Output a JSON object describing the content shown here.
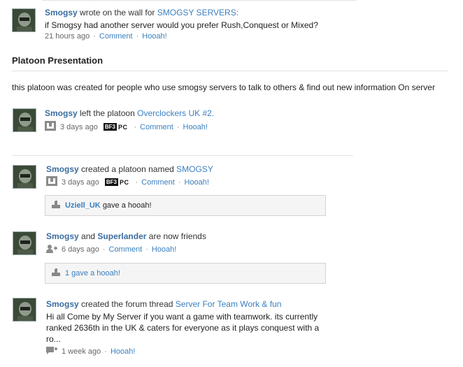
{
  "feed": [
    {
      "user": "Smogsy",
      "action": "wrote on the wall for",
      "target": "SMOGSY SERVERS:",
      "body": "if Smogsy had another server would you prefer Rush,Conquest or Mixed?",
      "time": "21 hours ago",
      "comment": "Comment",
      "hooah": "Hooah!"
    }
  ],
  "platoon": {
    "heading": "Platoon Presentation",
    "description": "this platoon was created for people who use smogsy servers to talk to others & find out new information On server"
  },
  "events": [
    {
      "user": "Smogsy",
      "action": "left the platoon",
      "target": "Overclockers UK #2.",
      "time": "3 days ago",
      "platform_b": "BF3",
      "platform_pc": "PC",
      "comment": "Comment",
      "hooah": "Hooah!"
    },
    {
      "user": "Smogsy",
      "action": "created a platoon named",
      "target": "SMOGSY",
      "time": "3 days ago",
      "platform_b": "BF3",
      "platform_pc": "PC",
      "comment": "Comment",
      "hooah": "Hooah!",
      "box_user": "Uziell_UK",
      "box_text": "gave a hooah!"
    },
    {
      "user": "Smogsy",
      "conj": "and",
      "user2": "Superlander",
      "action": "are now friends",
      "time": "6 days ago",
      "comment": "Comment",
      "hooah": "Hooah!",
      "box_text": "1 gave a hooah!"
    },
    {
      "user": "Smogsy",
      "action": "created the forum thread",
      "target": "Server For Team Work & fun",
      "body_line1": "Hi all Come by My Server if you want a game with teamwork. its currently",
      "body_line2": "ranked 2636th in the UK & caters for everyone as it plays conquest with a",
      "body_line3": "ro...",
      "time": "1 week ago",
      "hooah": "Hooah!"
    }
  ],
  "colors": {
    "link": "#3a7fbf",
    "user": "#3a6da0",
    "divider": "#e2e2e2",
    "box_bg": "#f5f5f5"
  }
}
